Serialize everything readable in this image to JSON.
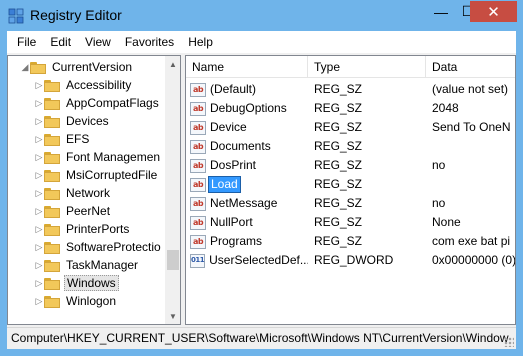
{
  "window": {
    "title": "Registry Editor",
    "minimize_glyph": "—",
    "maximize_glyph": "☐",
    "close_glyph": "✕",
    "accent_color": "#6fb4ea",
    "close_color": "#c74d42"
  },
  "menu": [
    "File",
    "Edit",
    "View",
    "Favorites",
    "Help"
  ],
  "tree": {
    "items": [
      {
        "label": "CurrentVersion",
        "expanded": true,
        "depth": 0,
        "selected": false
      },
      {
        "label": "Accessibility",
        "expanded": false,
        "depth": 1,
        "selected": false
      },
      {
        "label": "AppCompatFlags",
        "expanded": false,
        "depth": 1,
        "selected": false
      },
      {
        "label": "Devices",
        "expanded": false,
        "depth": 1,
        "selected": false
      },
      {
        "label": "EFS",
        "expanded": false,
        "depth": 1,
        "selected": false
      },
      {
        "label": "Font Managemen",
        "expanded": false,
        "depth": 1,
        "selected": false
      },
      {
        "label": "MsiCorruptedFile",
        "expanded": false,
        "depth": 1,
        "selected": false
      },
      {
        "label": "Network",
        "expanded": false,
        "depth": 1,
        "selected": false
      },
      {
        "label": "PeerNet",
        "expanded": false,
        "depth": 1,
        "selected": false
      },
      {
        "label": "PrinterPorts",
        "expanded": false,
        "depth": 1,
        "selected": false
      },
      {
        "label": "SoftwareProtectio",
        "expanded": false,
        "depth": 1,
        "selected": false
      },
      {
        "label": "TaskManager",
        "expanded": false,
        "depth": 1,
        "selected": false
      },
      {
        "label": "Windows",
        "expanded": false,
        "depth": 1,
        "selected": true
      },
      {
        "label": "Winlogon",
        "expanded": false,
        "depth": 1,
        "selected": false
      }
    ]
  },
  "list": {
    "columns": {
      "name": "Name",
      "type": "Type",
      "data": "Data"
    },
    "rows": [
      {
        "name": "(Default)",
        "type": "REG_SZ",
        "data": "(value not set)",
        "icon": "string-value-icon",
        "editing": false
      },
      {
        "name": "DebugOptions",
        "type": "REG_SZ",
        "data": "2048",
        "icon": "string-value-icon",
        "editing": false
      },
      {
        "name": "Device",
        "type": "REG_SZ",
        "data": "Send To OneN",
        "icon": "string-value-icon",
        "editing": false
      },
      {
        "name": "Documents",
        "type": "REG_SZ",
        "data": "",
        "icon": "string-value-icon",
        "editing": false
      },
      {
        "name": "DosPrint",
        "type": "REG_SZ",
        "data": "no",
        "icon": "string-value-icon",
        "editing": false
      },
      {
        "name": "Load",
        "type": "REG_SZ",
        "data": "",
        "icon": "string-value-icon",
        "editing": true
      },
      {
        "name": "NetMessage",
        "type": "REG_SZ",
        "data": "no",
        "icon": "string-value-icon",
        "editing": false
      },
      {
        "name": "NullPort",
        "type": "REG_SZ",
        "data": "None",
        "icon": "string-value-icon",
        "editing": false
      },
      {
        "name": "Programs",
        "type": "REG_SZ",
        "data": "com exe bat pi",
        "icon": "string-value-icon",
        "editing": false
      },
      {
        "name": "UserSelectedDef...",
        "type": "REG_DWORD",
        "data": "0x00000000 (0)",
        "icon": "binary-value-icon",
        "editing": false
      }
    ]
  },
  "status": {
    "path": "Computer\\HKEY_CURRENT_USER\\Software\\Microsoft\\Windows NT\\CurrentVersion\\Window"
  }
}
